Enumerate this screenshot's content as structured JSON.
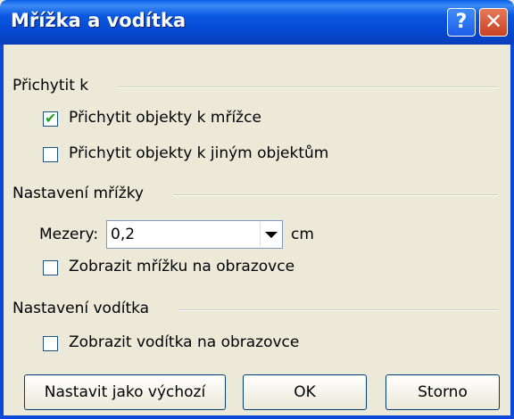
{
  "window": {
    "title": "Mřížka a vodítka",
    "help_label": "?",
    "close_label": "✕"
  },
  "snap": {
    "heading": "Přichytit k",
    "to_grid": {
      "label": "Přichytit objekty k mřížce",
      "checked": true
    },
    "to_objects": {
      "label": "Přichytit objekty k jiným objektům",
      "checked": false
    }
  },
  "grid_settings": {
    "heading": "Nastavení mřížky",
    "spacing_label": "Mezery:",
    "spacing_value": "0,2",
    "unit": "cm",
    "show_grid": {
      "label": "Zobrazit mřížku na obrazovce",
      "checked": false
    }
  },
  "guide_settings": {
    "heading": "Nastavení vodítka",
    "show_guides": {
      "label": "Zobrazit vodítka na obrazovce",
      "checked": false
    }
  },
  "buttons": {
    "set_default": "Nastavit jako výchozí",
    "ok": "OK",
    "cancel": "Storno"
  },
  "icons": {
    "check_mark": "check-mark-icon",
    "dropdown": "chevron-down-icon"
  }
}
